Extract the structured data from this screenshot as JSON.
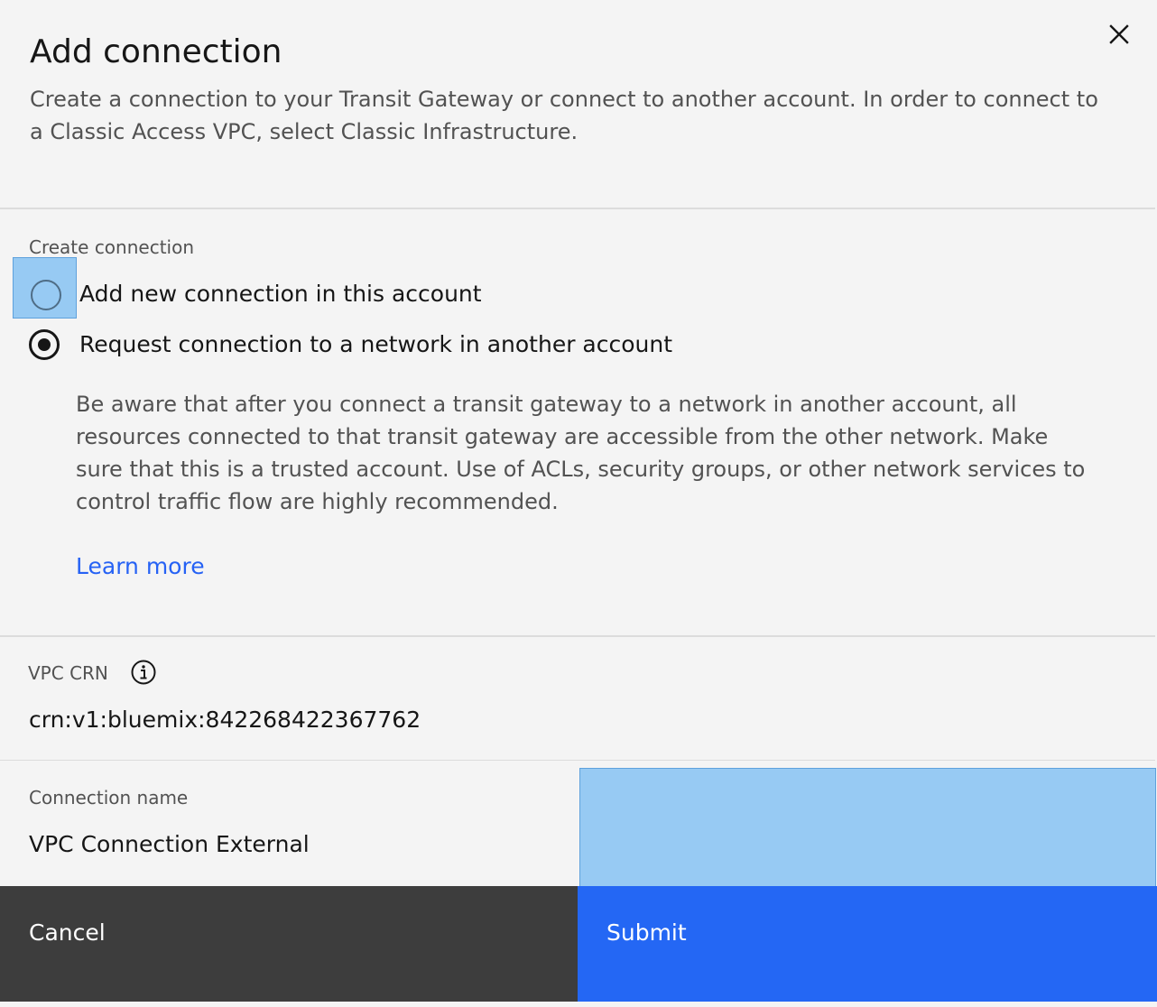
{
  "modal": {
    "title": "Add connection",
    "description": "Create a connection to your Transit Gateway or connect to another account. In order to connect to a Classic Access VPC, select Classic Infrastructure.",
    "close_icon": "close-icon"
  },
  "create_connection": {
    "label": "Create connection",
    "options": [
      {
        "label": "Add new connection in this account",
        "selected": false
      },
      {
        "label": "Request connection to a network in another account",
        "selected": true
      }
    ],
    "notice": "Be aware that after you connect a transit gateway to a network in another account, all resources connected to that transit gateway are accessible from the other network. Make sure that this is a trusted account. Use of ACLs, security groups, or other network services to control traffic flow are highly recommended.",
    "learn_more": "Learn more"
  },
  "vpc_crn": {
    "label": "VPC CRN",
    "info_icon": "info-icon",
    "value": "crn:v1:bluemix:842268422367762"
  },
  "connection_name": {
    "label": "Connection name",
    "value": "VPC Connection External"
  },
  "footer": {
    "cancel_label": "Cancel",
    "submit_label": "Submit"
  },
  "colors": {
    "background": "#f4f4f4",
    "primary": "#2467f4",
    "secondary": "#3d3d3d",
    "link": "#2662f4",
    "highlight": "#97caf3"
  }
}
